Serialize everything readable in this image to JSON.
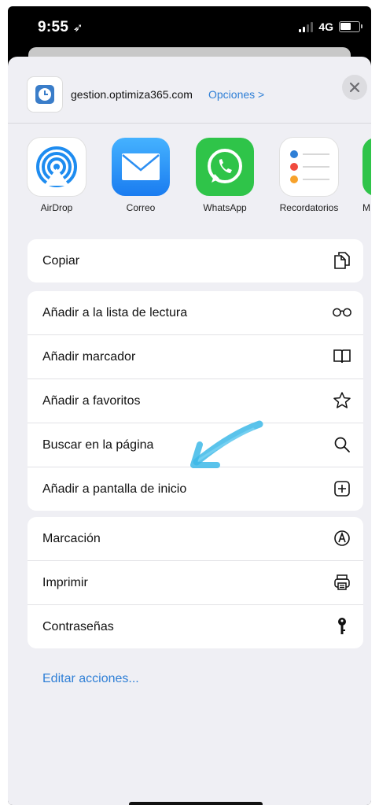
{
  "status": {
    "time": "9:55",
    "network": "4G"
  },
  "share_header": {
    "url": "gestion.optimiza365.com",
    "options_label": "Opciones >"
  },
  "apps": [
    {
      "label": "AirDrop",
      "icon": "airdrop-icon"
    },
    {
      "label": "Correo",
      "icon": "mail-icon"
    },
    {
      "label": "WhatsApp",
      "icon": "whatsapp-icon"
    },
    {
      "label": "Recordatorios",
      "icon": "reminders-icon"
    },
    {
      "label": "M",
      "icon": "messages-icon"
    }
  ],
  "groups": {
    "copy": [
      {
        "label": "Copiar",
        "icon": "copy-icon"
      }
    ],
    "actions": [
      {
        "label": "Añadir a la lista de lectura",
        "icon": "glasses-icon"
      },
      {
        "label": "Añadir marcador",
        "icon": "book-icon"
      },
      {
        "label": "Añadir a favoritos",
        "icon": "star-icon"
      },
      {
        "label": "Buscar en la página",
        "icon": "search-icon"
      },
      {
        "label": "Añadir a pantalla de inicio",
        "icon": "add-square-icon"
      }
    ],
    "more": [
      {
        "label": "Marcación",
        "icon": "markup-icon"
      },
      {
        "label": "Imprimir",
        "icon": "printer-icon"
      },
      {
        "label": "Contraseñas",
        "icon": "key-icon"
      }
    ]
  },
  "edit_actions_label": "Editar acciones...",
  "colors": {
    "link_blue": "#2f7fd6",
    "whatsapp_green": "#2fc449",
    "annotation_arrow": "#3db8e8"
  }
}
